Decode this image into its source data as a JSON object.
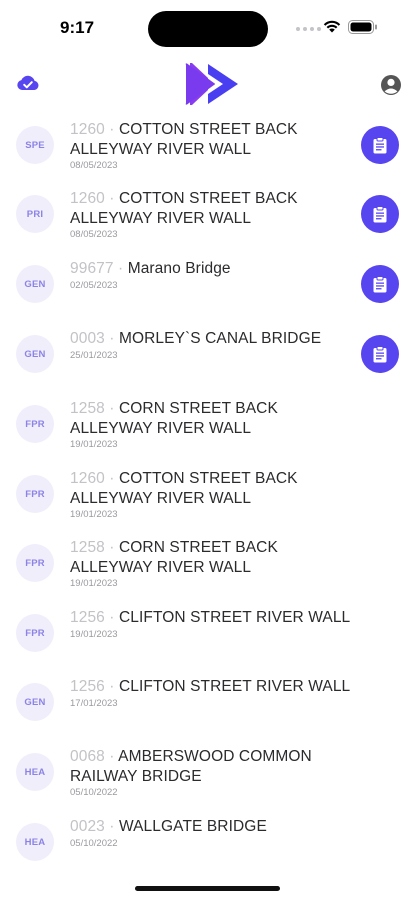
{
  "status_bar": {
    "time": "9:17"
  },
  "colors": {
    "accent": "#5745f0",
    "avatar_bg": "#f0eefb",
    "avatar_text": "#8c83e6",
    "muted": "#c2c2c7"
  },
  "header": {
    "left_icon": "cloud-check-icon",
    "logo_icon": "double-play-logo",
    "right_icon": "profile-icon"
  },
  "items": [
    {
      "code": "SPE",
      "id": "1260",
      "name": "COTTON STREET BACK ALLEYWAY RIVER WALL",
      "date": "08/05/2023",
      "has_action": true
    },
    {
      "code": "PRI",
      "id": "1260",
      "name": "COTTON STREET BACK ALLEYWAY RIVER WALL",
      "date": "08/05/2023",
      "has_action": true
    },
    {
      "code": "GEN",
      "id": "99677",
      "name": "Marano Bridge",
      "date": "02/05/2023",
      "has_action": true
    },
    {
      "code": "GEN",
      "id": "0003",
      "name": "MORLEY`S CANAL BRIDGE",
      "date": "25/01/2023",
      "has_action": true
    },
    {
      "code": "FPR",
      "id": "1258",
      "name": "CORN STREET BACK ALLEYWAY RIVER WALL",
      "date": "19/01/2023",
      "has_action": false
    },
    {
      "code": "FPR",
      "id": "1260",
      "name": "COTTON STREET BACK ALLEYWAY RIVER WALL",
      "date": "19/01/2023",
      "has_action": false
    },
    {
      "code": "FPR",
      "id": "1258",
      "name": "CORN STREET BACK ALLEYWAY RIVER WALL",
      "date": "19/01/2023",
      "has_action": false
    },
    {
      "code": "FPR",
      "id": "1256",
      "name": "CLIFTON STREET RIVER WALL",
      "date": "19/01/2023",
      "has_action": false
    },
    {
      "code": "GEN",
      "id": "1256",
      "name": "CLIFTON STREET RIVER WALL",
      "date": "17/01/2023",
      "has_action": false
    },
    {
      "code": "HEA",
      "id": "0068",
      "name": "AMBERSWOOD COMMON RAILWAY BRIDGE",
      "date": "05/10/2022",
      "has_action": false
    },
    {
      "code": "HEA",
      "id": "0023",
      "name": "WALLGATE BRIDGE",
      "date": "05/10/2022",
      "has_action": false
    }
  ]
}
